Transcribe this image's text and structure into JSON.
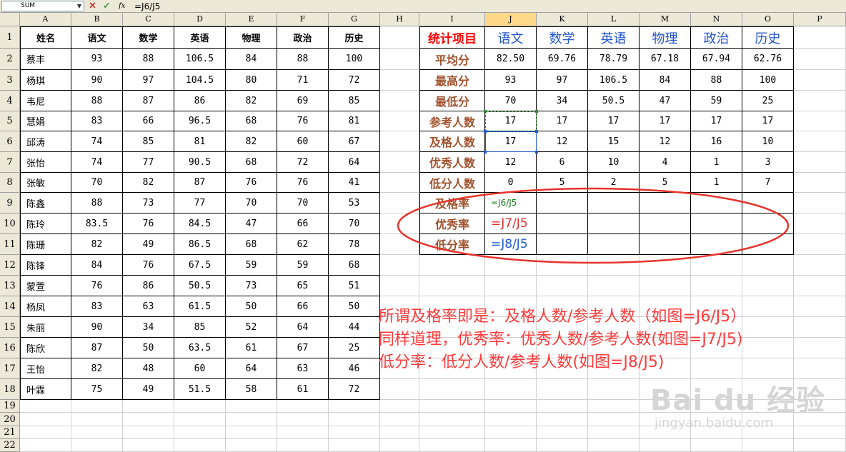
{
  "formula_bar": {
    "name_box": "SUM",
    "fx_label": "fx",
    "formula": "=J6/J5"
  },
  "columns": [
    "A",
    "B",
    "C",
    "D",
    "E",
    "F",
    "G",
    "H",
    "I",
    "J",
    "K",
    "L",
    "M",
    "N",
    "O",
    "P"
  ],
  "rows": [
    "1",
    "2",
    "3",
    "4",
    "5",
    "6",
    "7",
    "8",
    "9",
    "10",
    "11",
    "12",
    "13",
    "14",
    "15",
    "16",
    "17",
    "18",
    "19",
    "20",
    "21",
    "22"
  ],
  "students": {
    "headers": [
      "姓名",
      "语文",
      "数学",
      "英语",
      "物理",
      "政治",
      "历史"
    ],
    "rows": [
      [
        "蔡丰",
        "93",
        "88",
        "106.5",
        "84",
        "88",
        "100"
      ],
      [
        "杨琪",
        "90",
        "97",
        "104.5",
        "80",
        "71",
        "72"
      ],
      [
        "韦尼",
        "88",
        "87",
        "86",
        "82",
        "69",
        "85"
      ],
      [
        "慧娟",
        "83",
        "66",
        "96.5",
        "68",
        "76",
        "81"
      ],
      [
        "邱涛",
        "74",
        "85",
        "81",
        "82",
        "60",
        "67"
      ],
      [
        "张怡",
        "74",
        "77",
        "90.5",
        "68",
        "72",
        "64"
      ],
      [
        "张敏",
        "70",
        "82",
        "87",
        "76",
        "76",
        "41"
      ],
      [
        "陈鑫",
        "88",
        "73",
        "77",
        "70",
        "70",
        "53"
      ],
      [
        "陈玲",
        "83.5",
        "76",
        "84.5",
        "47",
        "66",
        "70"
      ],
      [
        "陈珊",
        "82",
        "49",
        "86.5",
        "68",
        "62",
        "78"
      ],
      [
        "陈锋",
        "84",
        "76",
        "67.5",
        "59",
        "59",
        "68"
      ],
      [
        "蒙萱",
        "76",
        "86",
        "50.5",
        "73",
        "65",
        "51"
      ],
      [
        "杨凤",
        "83",
        "63",
        "61.5",
        "50",
        "66",
        "50"
      ],
      [
        "朱丽",
        "90",
        "34",
        "85",
        "52",
        "64",
        "44"
      ],
      [
        "陈欣",
        "87",
        "50",
        "63.5",
        "61",
        "67",
        "25"
      ],
      [
        "王怡",
        "82",
        "48",
        "60",
        "64",
        "63",
        "46"
      ],
      [
        "叶霖",
        "75",
        "49",
        "51.5",
        "58",
        "61",
        "72"
      ]
    ]
  },
  "stats": {
    "title": "统计项目",
    "subjects": [
      "语文",
      "数学",
      "英语",
      "物理",
      "政治",
      "历史"
    ],
    "rows": [
      {
        "label": "平均分",
        "values": [
          "82.50",
          "69.76",
          "78.79",
          "67.18",
          "67.94",
          "62.76"
        ]
      },
      {
        "label": "最高分",
        "values": [
          "93",
          "97",
          "106.5",
          "84",
          "88",
          "100"
        ]
      },
      {
        "label": "最低分",
        "values": [
          "70",
          "34",
          "50.5",
          "47",
          "59",
          "25"
        ]
      },
      {
        "label": "参考人数",
        "values": [
          "17",
          "17",
          "17",
          "17",
          "17",
          "17"
        ]
      },
      {
        "label": "及格人数",
        "values": [
          "17",
          "12",
          "15",
          "12",
          "16",
          "10"
        ]
      },
      {
        "label": "优秀人数",
        "values": [
          "12",
          "6",
          "10",
          "4",
          "1",
          "3"
        ]
      },
      {
        "label": "低分人数",
        "values": [
          "0",
          "5",
          "2",
          "5",
          "1",
          "7"
        ]
      },
      {
        "label": "及格率",
        "values": [
          "=J6/J5",
          "",
          "",
          "",
          "",
          ""
        ]
      },
      {
        "label": "优秀率",
        "values": [
          "=J7/J5",
          "",
          "",
          "",
          "",
          ""
        ]
      },
      {
        "label": "低分率",
        "values": [
          "=J8/J5",
          "",
          "",
          "",
          "",
          ""
        ]
      }
    ]
  },
  "annotation": {
    "lines": [
      "所谓及格率即是：及格人数/参考人数（如图=J6/J5）",
      "同样道理，优秀率：优秀人数/参考人数(如图=J7/J5)",
      "低分率：低分人数/参考人数(如图=J8/J5)"
    ]
  },
  "watermark": {
    "main": "Bai du 经验",
    "sub": "jingyan.baidu.com"
  },
  "colors": {
    "annotation": "#ff3b3b",
    "stat_title": "#ff0000",
    "stat_label": "#a0522d",
    "subject_header": "#2255cc",
    "ellipse": "#e8332b"
  }
}
